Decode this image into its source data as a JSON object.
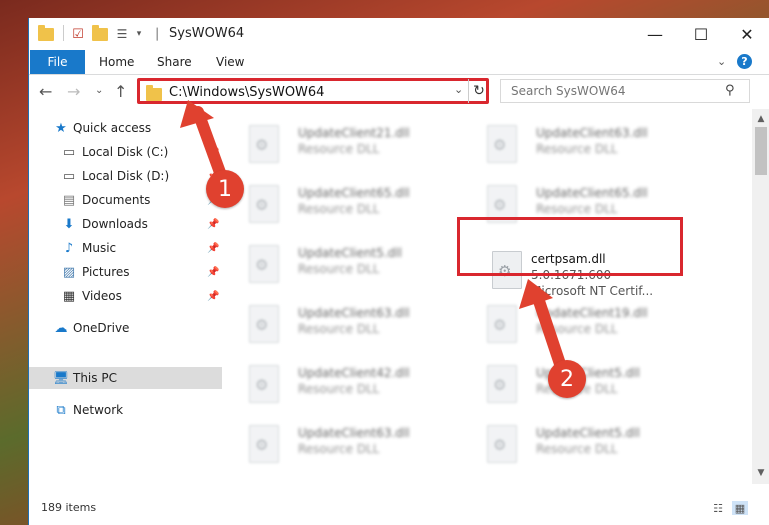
{
  "window": {
    "title": "SysWOW64",
    "controls": {
      "minimize": "—",
      "maximize": "☐",
      "close": "✕"
    }
  },
  "ribbon": {
    "tabs": [
      "File",
      "Home",
      "Share",
      "View"
    ],
    "help": "?"
  },
  "address_bar": {
    "path": "C:\\Windows\\SysWOW64"
  },
  "search": {
    "placeholder": "Search SysWOW64"
  },
  "sidebar": {
    "items": [
      {
        "label": "Quick access",
        "icon": "star-icon"
      },
      {
        "label": "Local Disk (C:)",
        "icon": "drive-icon"
      },
      {
        "label": "Local Disk (D:)",
        "icon": "drive-icon"
      },
      {
        "label": "Documents",
        "icon": "document-icon"
      },
      {
        "label": "Downloads",
        "icon": "download-icon"
      },
      {
        "label": "Music",
        "icon": "music-icon"
      },
      {
        "label": "Pictures",
        "icon": "picture-icon"
      },
      {
        "label": "Videos",
        "icon": "video-icon"
      },
      {
        "label": "OneDrive",
        "icon": "cloud-icon"
      },
      {
        "label": "This PC",
        "icon": "computer-icon"
      },
      {
        "label": "Network",
        "icon": "network-icon"
      }
    ]
  },
  "files": {
    "left_column": [
      {
        "name": "UpdateClient21.dll",
        "type": "Resource DLL"
      },
      {
        "name": "UpdateClient65.dll",
        "type": "Resource DLL"
      },
      {
        "name": "UpdateClient5.dll",
        "type": "Resource DLL"
      },
      {
        "name": "UpdateClient63.dll",
        "type": "Resource DLL"
      },
      {
        "name": "UpdateClient42.dll",
        "type": "Resource DLL"
      },
      {
        "name": "UpdateClient63.dll",
        "type": "Resource DLL"
      }
    ],
    "right_column": [
      {
        "name": "UpdateClient63.dll",
        "type": "Resource DLL"
      },
      {
        "name": "UpdateClient65.dll",
        "type": "Resource DLL"
      },
      {
        "name": "UpdateClient19.dll",
        "type": "Resource DLL"
      },
      {
        "name": "UpdateClient5.dll",
        "type": "Resource DLL"
      },
      {
        "name": "UpdateClient5.dll",
        "type": "Resource DLL"
      }
    ],
    "highlighted": {
      "name": "certpsam.dll",
      "version": "5.0.1671.600",
      "description": "Microsoft NT Certif..."
    }
  },
  "status": {
    "item_count": "189 items"
  },
  "annotations": {
    "step1": "1",
    "step2": "2",
    "highlight_color": "#d9272e",
    "badge_color": "#e0412f"
  }
}
